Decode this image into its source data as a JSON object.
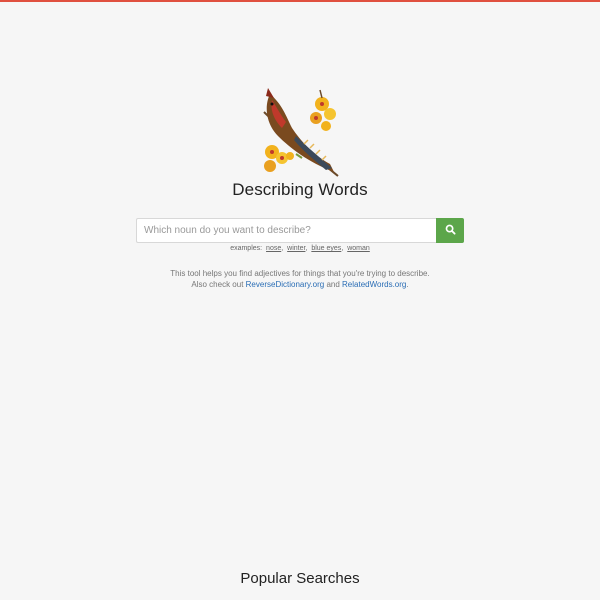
{
  "colors": {
    "top_bar": "#e0503f",
    "search_button": "#5ca64a",
    "link": "#2a6db5"
  },
  "header": {
    "logo_icon": "bird-on-branch-icon",
    "title": "Describing Words"
  },
  "search": {
    "placeholder": "Which noun do you want to describe?",
    "value": "",
    "button_icon": "search-icon"
  },
  "examples": {
    "label": "examples:",
    "items": [
      "nose",
      "winter",
      "blue eyes",
      "woman"
    ]
  },
  "description": {
    "line1": "This tool helps you find adjectives for things that you're trying to describe.",
    "line2_prefix": "Also check out",
    "link1": "ReverseDictionary.org",
    "and": "and",
    "link2": "RelatedWords.org",
    "suffix": "."
  },
  "popular": {
    "title": "Popular Searches"
  }
}
